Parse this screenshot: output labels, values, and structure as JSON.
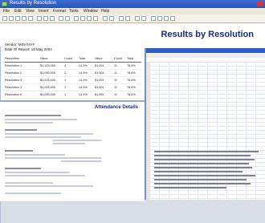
{
  "window": {
    "title": "Results by Resolution",
    "menu": [
      "File",
      "Edit",
      "View",
      "Insert",
      "Format",
      "Tools",
      "Window",
      "Help"
    ]
  },
  "report": {
    "title": "Results by Resolution",
    "vendor_label": "Vendor:",
    "vendor_value": "MSH HVY",
    "date_label": "Date Of Report:",
    "date_value": "18 May 2004",
    "columns": [
      "Resolution",
      "Value",
      "Count",
      "Total",
      "Value",
      "Count",
      "Total"
    ],
    "rows": [
      [
        "Resolution 1",
        "$1,125,000",
        "4",
        "14.3%",
        "$1,001",
        "11",
        "78.6%"
      ],
      [
        "Resolution 2",
        "$1,050,000",
        "2",
        "14.3%",
        "$1,001",
        "11",
        "78.6%"
      ],
      [
        "Resolution 3",
        "$1,025,000",
        "1",
        "14.3%",
        "$1,001",
        "11",
        "78.6%"
      ],
      [
        "Resolution 4",
        "$1,025,000",
        "1",
        "14.3%",
        "$1,001",
        "11",
        "78.6%"
      ],
      [
        "Resolution 5",
        "$1,020,000",
        "1",
        "14.3%",
        "$1,001",
        "11",
        "78.6%"
      ]
    ]
  },
  "second_doc": {
    "title": "Attendance Details"
  }
}
